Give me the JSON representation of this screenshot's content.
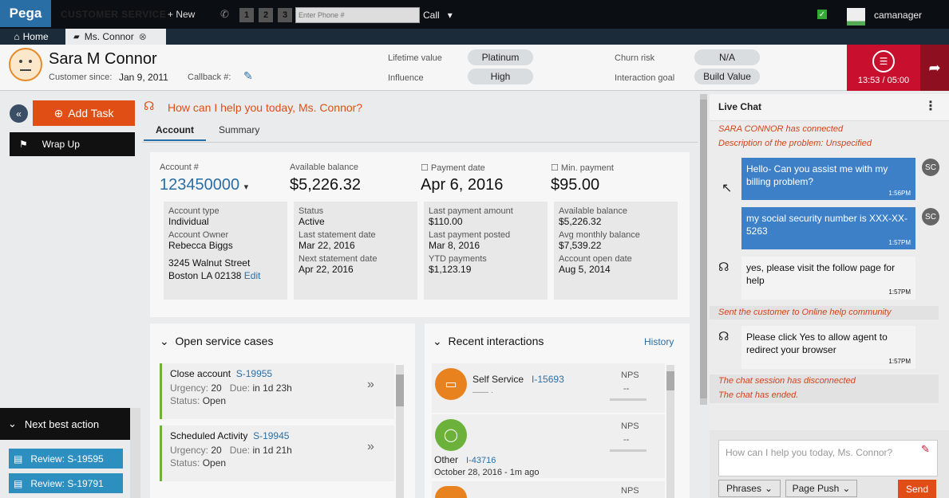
{
  "topbar": {
    "logo": "Pega",
    "app_name": "CUSTOMER SERVICE",
    "new_label": "+ New",
    "line_buttons": [
      "1",
      "2",
      "3"
    ],
    "phone_placeholder": "Enter Phone #",
    "call_label": "Call",
    "username": "camanager"
  },
  "tabs": {
    "home": "Home",
    "customer": "Ms. Connor"
  },
  "customer": {
    "name": "Sara M Connor",
    "since_label": "Customer since:",
    "since_value": "Jan 9, 2011",
    "callback_label": "Callback #:",
    "lifetime_value_label": "Lifetime value",
    "lifetime_value": "Platinum",
    "influence_label": "Influence",
    "influence": "High",
    "churn_risk_label": "Churn risk",
    "churn_risk": "N/A",
    "interaction_goal_label": "Interaction goal",
    "interaction_goal": "Build Value",
    "timer": "13:53 / 05:00"
  },
  "leftnav": {
    "add_task": "Add Task",
    "wrap_up": "Wrap Up",
    "next_best_action": "Next best action",
    "reviews": [
      "Review: S-19595",
      "Review: S-19791"
    ]
  },
  "main": {
    "greeting": "How can I help you today, Ms. Connor?",
    "tabs": [
      "Account",
      "Summary"
    ],
    "summary": {
      "account_label": "Account #",
      "account_value": "123450000",
      "available_balance_label": "Available balance",
      "available_balance": "$5,226.32",
      "payment_date_label": "Payment date",
      "payment_date": "Apr 6, 2016",
      "min_payment_label": "Min. payment",
      "min_payment": "$95.00"
    },
    "details": [
      [
        {
          "k": "Account type",
          "v": "Individual"
        },
        {
          "k": "Account Owner",
          "v": "Rebecca Biggs"
        },
        {
          "k": "",
          "v": "3245 Walnut Street"
        },
        {
          "k": "",
          "v": "Boston  LA  02138"
        }
      ],
      [
        {
          "k": "Status",
          "v": "Active"
        },
        {
          "k": "Last statement date",
          "v": "Mar 22, 2016"
        },
        {
          "k": "Next statement date",
          "v": "Apr 22, 2016"
        }
      ],
      [
        {
          "k": "Last payment amount",
          "v": "$110.00"
        },
        {
          "k": "Last payment posted",
          "v": "Mar 8, 2016"
        },
        {
          "k": "YTD payments",
          "v": "$1,123.19"
        }
      ],
      [
        {
          "k": "Available balance",
          "v": "$5,226.32"
        },
        {
          "k": "Avg monthly balance",
          "v": "$7,539.22"
        },
        {
          "k": "Account open date",
          "v": "Aug 5, 2014"
        }
      ]
    ],
    "edit_label": "Edit",
    "open_cases_title": "Open service cases",
    "cases": [
      {
        "title": "Close account",
        "id": "S-19955",
        "urgency_label": "Urgency:",
        "urgency": "20",
        "due_label": "Due:",
        "due": "in 1d 23h",
        "status_label": "Status:",
        "status": "Open"
      },
      {
        "title": "Scheduled Activity",
        "id": "S-19945",
        "urgency_label": "Urgency:",
        "urgency": "20",
        "due_label": "Due:",
        "due": "in 1d 21h",
        "status_label": "Status:",
        "status": "Open"
      }
    ],
    "recent_title": "Recent interactions",
    "history_label": "History",
    "interactions": [
      {
        "title": "Self Service",
        "id": "I-15693",
        "nps_label": "NPS",
        "nps": "--",
        "sub": "—— ·",
        "color": "#e8821e"
      },
      {
        "title": "Other",
        "id": "I-43716",
        "nps_label": "NPS",
        "nps": "--",
        "sub": "October 28, 2016   - 1m ago",
        "color": "#6bb13a"
      },
      {
        "nps_label": "NPS",
        "color": "#e8821e"
      }
    ]
  },
  "chat": {
    "title": "Live Chat",
    "sys1": "SARA CONNOR has connected",
    "sys2": "Description of the problem: Unspecified",
    "msg1": "Hello- Can you assist me with my billing problem?",
    "msg1_time": "1:56PM",
    "msg2": "my social security number is XXX-XX-5263",
    "msg2_time": "1:57PM",
    "msg3": "yes, please visit the follow page for help",
    "msg3_time": "1:57PM",
    "sys3": "Sent the customer to Online help community",
    "msg4": "Please click Yes to allow agent to redirect your browser",
    "msg4_time": "1:57PM",
    "sys4": "The chat session has disconnected",
    "sys5": "The chat has ended.",
    "customer_initials": "SC",
    "input_placeholder": "How can I help you today, Ms. Connor?",
    "phrases": "Phrases",
    "page_push": "Page Push",
    "send": "Send"
  },
  "colors": {
    "accent": "#e04e16",
    "timer": "#c8102e",
    "link": "#2a6ea6",
    "chat_customer": "#3d80c8"
  }
}
